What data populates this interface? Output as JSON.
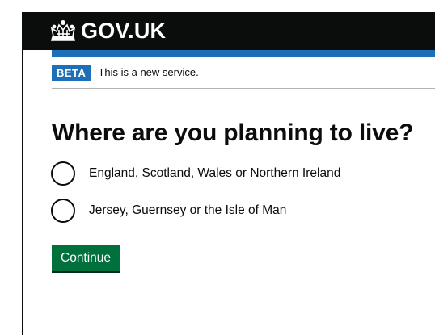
{
  "header": {
    "logo_text": "GOV.UK",
    "logo_icon": "crown-icon",
    "background_color": "#0b0c0c",
    "accent_bar_color": "#1d70b8"
  },
  "phase_banner": {
    "tag": "BETA",
    "text": "This is a new service.",
    "tag_color": "#1d70b8"
  },
  "question": {
    "heading": "Where are you planning to live?",
    "options": [
      {
        "label": "England, Scotland, Wales or Northern Ireland",
        "selected": false
      },
      {
        "label": "Jersey, Guernsey or the Isle of Man",
        "selected": false
      }
    ]
  },
  "actions": {
    "continue_label": "Continue",
    "button_color": "#00703c"
  }
}
